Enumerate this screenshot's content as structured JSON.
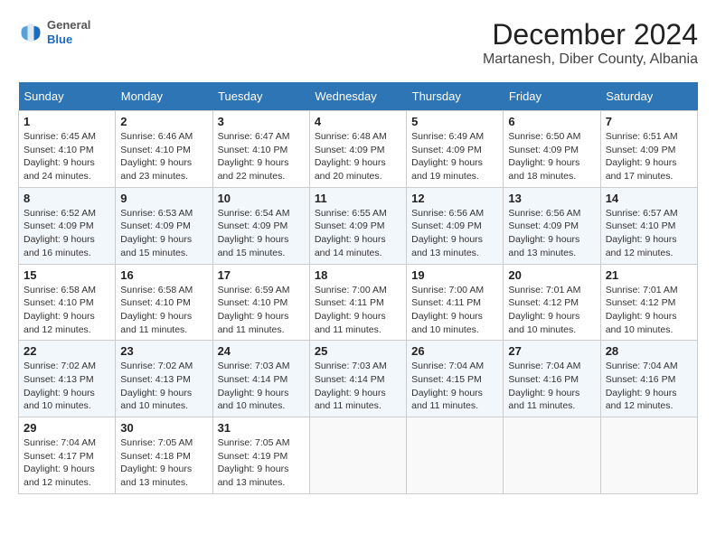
{
  "header": {
    "logo": {
      "general": "General",
      "blue": "Blue"
    },
    "title": "December 2024",
    "location": "Martanesh, Diber County, Albania"
  },
  "weekdays": [
    "Sunday",
    "Monday",
    "Tuesday",
    "Wednesday",
    "Thursday",
    "Friday",
    "Saturday"
  ],
  "weeks": [
    [
      {
        "day": 1,
        "sunrise": "6:45 AM",
        "sunset": "4:10 PM",
        "daylight": "9 hours and 24 minutes."
      },
      {
        "day": 2,
        "sunrise": "6:46 AM",
        "sunset": "4:10 PM",
        "daylight": "9 hours and 23 minutes."
      },
      {
        "day": 3,
        "sunrise": "6:47 AM",
        "sunset": "4:10 PM",
        "daylight": "9 hours and 22 minutes."
      },
      {
        "day": 4,
        "sunrise": "6:48 AM",
        "sunset": "4:09 PM",
        "daylight": "9 hours and 20 minutes."
      },
      {
        "day": 5,
        "sunrise": "6:49 AM",
        "sunset": "4:09 PM",
        "daylight": "9 hours and 19 minutes."
      },
      {
        "day": 6,
        "sunrise": "6:50 AM",
        "sunset": "4:09 PM",
        "daylight": "9 hours and 18 minutes."
      },
      {
        "day": 7,
        "sunrise": "6:51 AM",
        "sunset": "4:09 PM",
        "daylight": "9 hours and 17 minutes."
      }
    ],
    [
      {
        "day": 8,
        "sunrise": "6:52 AM",
        "sunset": "4:09 PM",
        "daylight": "9 hours and 16 minutes."
      },
      {
        "day": 9,
        "sunrise": "6:53 AM",
        "sunset": "4:09 PM",
        "daylight": "9 hours and 15 minutes."
      },
      {
        "day": 10,
        "sunrise": "6:54 AM",
        "sunset": "4:09 PM",
        "daylight": "9 hours and 15 minutes."
      },
      {
        "day": 11,
        "sunrise": "6:55 AM",
        "sunset": "4:09 PM",
        "daylight": "9 hours and 14 minutes."
      },
      {
        "day": 12,
        "sunrise": "6:56 AM",
        "sunset": "4:09 PM",
        "daylight": "9 hours and 13 minutes."
      },
      {
        "day": 13,
        "sunrise": "6:56 AM",
        "sunset": "4:09 PM",
        "daylight": "9 hours and 13 minutes."
      },
      {
        "day": 14,
        "sunrise": "6:57 AM",
        "sunset": "4:10 PM",
        "daylight": "9 hours and 12 minutes."
      }
    ],
    [
      {
        "day": 15,
        "sunrise": "6:58 AM",
        "sunset": "4:10 PM",
        "daylight": "9 hours and 12 minutes."
      },
      {
        "day": 16,
        "sunrise": "6:58 AM",
        "sunset": "4:10 PM",
        "daylight": "9 hours and 11 minutes."
      },
      {
        "day": 17,
        "sunrise": "6:59 AM",
        "sunset": "4:10 PM",
        "daylight": "9 hours and 11 minutes."
      },
      {
        "day": 18,
        "sunrise": "7:00 AM",
        "sunset": "4:11 PM",
        "daylight": "9 hours and 11 minutes."
      },
      {
        "day": 19,
        "sunrise": "7:00 AM",
        "sunset": "4:11 PM",
        "daylight": "9 hours and 10 minutes."
      },
      {
        "day": 20,
        "sunrise": "7:01 AM",
        "sunset": "4:12 PM",
        "daylight": "9 hours and 10 minutes."
      },
      {
        "day": 21,
        "sunrise": "7:01 AM",
        "sunset": "4:12 PM",
        "daylight": "9 hours and 10 minutes."
      }
    ],
    [
      {
        "day": 22,
        "sunrise": "7:02 AM",
        "sunset": "4:13 PM",
        "daylight": "9 hours and 10 minutes."
      },
      {
        "day": 23,
        "sunrise": "7:02 AM",
        "sunset": "4:13 PM",
        "daylight": "9 hours and 10 minutes."
      },
      {
        "day": 24,
        "sunrise": "7:03 AM",
        "sunset": "4:14 PM",
        "daylight": "9 hours and 10 minutes."
      },
      {
        "day": 25,
        "sunrise": "7:03 AM",
        "sunset": "4:14 PM",
        "daylight": "9 hours and 11 minutes."
      },
      {
        "day": 26,
        "sunrise": "7:04 AM",
        "sunset": "4:15 PM",
        "daylight": "9 hours and 11 minutes."
      },
      {
        "day": 27,
        "sunrise": "7:04 AM",
        "sunset": "4:16 PM",
        "daylight": "9 hours and 11 minutes."
      },
      {
        "day": 28,
        "sunrise": "7:04 AM",
        "sunset": "4:16 PM",
        "daylight": "9 hours and 12 minutes."
      }
    ],
    [
      {
        "day": 29,
        "sunrise": "7:04 AM",
        "sunset": "4:17 PM",
        "daylight": "9 hours and 12 minutes."
      },
      {
        "day": 30,
        "sunrise": "7:05 AM",
        "sunset": "4:18 PM",
        "daylight": "9 hours and 13 minutes."
      },
      {
        "day": 31,
        "sunrise": "7:05 AM",
        "sunset": "4:19 PM",
        "daylight": "9 hours and 13 minutes."
      },
      null,
      null,
      null,
      null
    ]
  ]
}
